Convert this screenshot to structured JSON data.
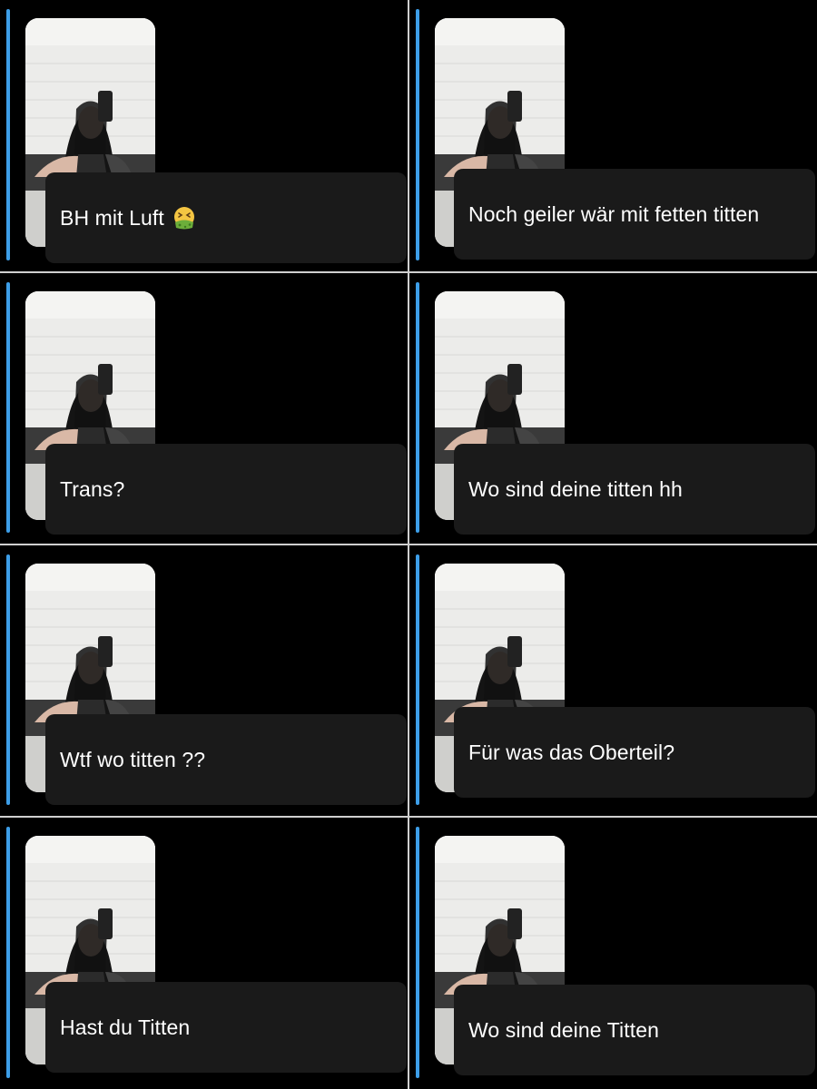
{
  "panels": [
    {
      "reply": "BH mit Luft",
      "emoji": "nauseated-face-icon"
    },
    {
      "reply": "Noch geiler wär mit fetten titten",
      "emoji": ""
    },
    {
      "reply": "Trans?",
      "emoji": ""
    },
    {
      "reply": "Wo sind deine titten hh",
      "emoji": ""
    },
    {
      "reply": "Wtf wo titten ??",
      "emoji": ""
    },
    {
      "reply": "Für was das Oberteil?",
      "emoji": ""
    },
    {
      "reply": "Hast du Titten",
      "emoji": ""
    },
    {
      "reply": "Wo sind deine Titten",
      "emoji": ""
    }
  ],
  "colors": {
    "background": "#000000",
    "bubble": "#1a1a1a",
    "accent": "#3d9ee8",
    "text": "#ffffff",
    "divider": "#cfcfcf"
  }
}
